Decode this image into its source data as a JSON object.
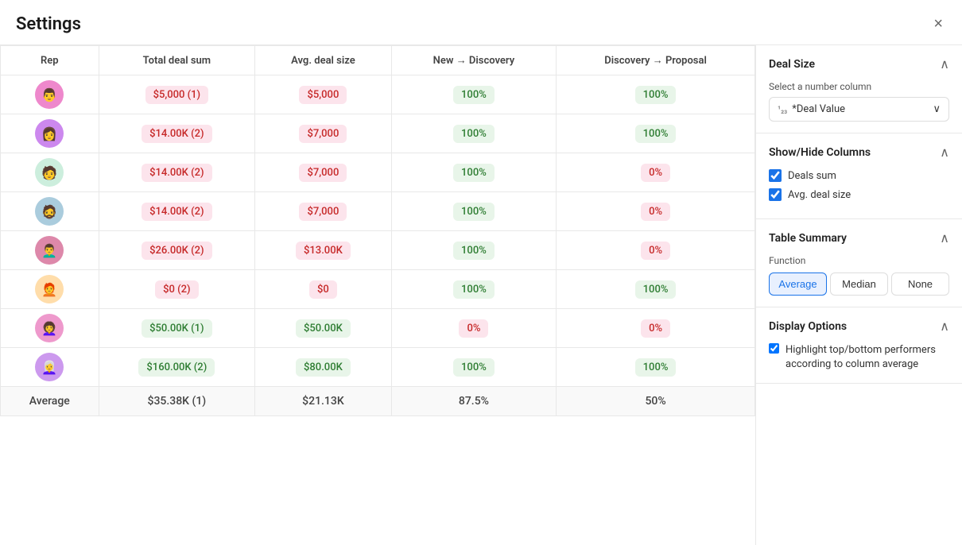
{
  "modal": {
    "title": "Settings",
    "close_label": "×"
  },
  "table": {
    "columns": [
      {
        "key": "rep",
        "label": "Rep"
      },
      {
        "key": "total_deal_sum",
        "label": "Total deal sum"
      },
      {
        "key": "avg_deal_size",
        "label": "Avg. deal size"
      },
      {
        "key": "new_to_discovery",
        "label": "New → Discovery"
      },
      {
        "key": "discovery_to_proposal",
        "label": "Discovery → Proposal"
      }
    ],
    "rows": [
      {
        "rep_emoji": "👨",
        "total_deal_sum": "$5,000 (1)",
        "total_type": "pink",
        "avg_deal_size": "$5,000",
        "avg_type": "pink",
        "new_disc": "100%",
        "new_disc_type": "green",
        "disc_prop": "100%",
        "disc_prop_type": "green"
      },
      {
        "rep_emoji": "👩",
        "total_deal_sum": "$14.00K (2)",
        "total_type": "pink",
        "avg_deal_size": "$7,000",
        "avg_type": "pink",
        "new_disc": "100%",
        "new_disc_type": "green",
        "disc_prop": "100%",
        "disc_prop_type": "green"
      },
      {
        "rep_emoji": "🧑",
        "total_deal_sum": "$14.00K (2)",
        "total_type": "pink",
        "avg_deal_size": "$7,000",
        "avg_type": "pink",
        "new_disc": "100%",
        "new_disc_type": "green",
        "disc_prop": "0%",
        "disc_prop_type": "pink"
      },
      {
        "rep_emoji": "🧔",
        "total_deal_sum": "$14.00K (2)",
        "total_type": "pink",
        "avg_deal_size": "$7,000",
        "avg_type": "pink",
        "new_disc": "100%",
        "new_disc_type": "green",
        "disc_prop": "0%",
        "disc_prop_type": "pink"
      },
      {
        "rep_emoji": "👨‍🦱",
        "total_deal_sum": "$26.00K (2)",
        "total_type": "pink",
        "avg_deal_size": "$13.00K",
        "avg_type": "pink",
        "new_disc": "100%",
        "new_disc_type": "green",
        "disc_prop": "0%",
        "disc_prop_type": "pink"
      },
      {
        "rep_emoji": "🧑‍🦰",
        "total_deal_sum": "$0 (2)",
        "total_type": "pink",
        "avg_deal_size": "$0",
        "avg_type": "pink",
        "new_disc": "100%",
        "new_disc_type": "green",
        "disc_prop": "100%",
        "disc_prop_type": "green"
      },
      {
        "rep_emoji": "👩‍🦱",
        "total_deal_sum": "$50.00K (1)",
        "total_type": "green",
        "avg_deal_size": "$50.00K",
        "avg_type": "green",
        "new_disc": "0%",
        "new_disc_type": "pink",
        "disc_prop": "0%",
        "disc_prop_type": "pink"
      },
      {
        "rep_emoji": "👩‍🦳",
        "total_deal_sum": "$160.00K (2)",
        "total_type": "green",
        "avg_deal_size": "$80.00K",
        "avg_type": "green",
        "new_disc": "100%",
        "new_disc_type": "green",
        "disc_prop": "100%",
        "disc_prop_type": "green"
      }
    ],
    "summary": {
      "label": "Average",
      "total_deal_sum": "$35.38K (1)",
      "avg_deal_size": "$21.13K",
      "new_disc": "87.5%",
      "disc_prop": "50%"
    }
  },
  "sidebar": {
    "deal_size": {
      "title": "Deal Size",
      "select_label": "Select a number column",
      "selected_value": "*Deal Value",
      "num_icon": "¹₂₃"
    },
    "show_hide_columns": {
      "title": "Show/Hide Columns",
      "columns": [
        {
          "label": "Deals sum",
          "checked": true
        },
        {
          "label": "Avg. deal size",
          "checked": true
        }
      ]
    },
    "table_summary": {
      "title": "Table Summary",
      "function_label": "Function",
      "functions": [
        {
          "label": "Average",
          "active": true
        },
        {
          "label": "Median",
          "active": false
        },
        {
          "label": "None",
          "active": false
        }
      ]
    },
    "display_options": {
      "title": "Display Options",
      "highlight_label": "Highlight top/bottom performers according to column average",
      "highlight_checked": true
    }
  }
}
